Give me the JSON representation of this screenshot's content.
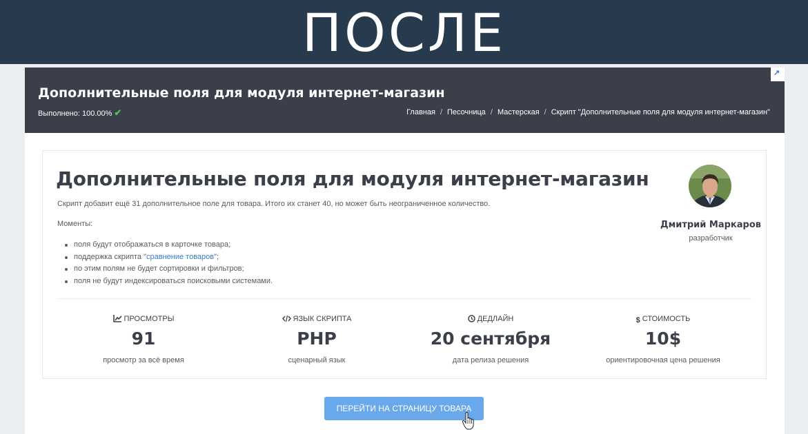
{
  "banner": {
    "text": "ПОСЛЕ"
  },
  "header": {
    "title": "Дополнительные поля для модуля интернет-магазин",
    "progress_label": "Выполнено: 100.00%",
    "breadcrumb": [
      "Главная",
      "Песочница",
      "Мастерская",
      "Скрипт \"Дополнительные поля для модуля интернет-магазин\""
    ]
  },
  "card": {
    "title": "Дополнительные поля для модуля интернет-магазин",
    "description": "Скрипт добавит ещё 31 дополнительное поле для товара. Итого их станет 40, но может быть неограниченное количество.",
    "moments_label": "Моменты:",
    "list": {
      "item1": "поля будут отображаться в карточке товара;",
      "item2_prefix": "поддержка скрипта \"",
      "item2_link": "сравнение товаров",
      "item2_suffix": "\";",
      "item3": "по этим полям не будет сортировки и фильтров;",
      "item4": "поля не будут индексироваться поисковыми системами."
    },
    "author": {
      "name": "Дмитрий Маркаров",
      "role": "разработчик"
    }
  },
  "stats": [
    {
      "icon": "chart-icon",
      "label": "ПРОСМОТРЫ",
      "value": "91",
      "sub": "просмотр за всё время"
    },
    {
      "icon": "code-icon",
      "label": "ЯЗЫК СКРИПТА",
      "value": "PHP",
      "sub": "сценарный язык"
    },
    {
      "icon": "clock-icon",
      "label": "ДЕДЛАЙН",
      "value": "20 сентября",
      "sub": "дата релиза решения"
    },
    {
      "icon": "dollar-icon",
      "label": "СТОИМОСТЬ",
      "value": "10$",
      "sub": "ориентировочная цена решения"
    }
  ],
  "cta": {
    "label": "ПЕРЕЙТИ НА СТРАНИЦУ ТОВАРА"
  },
  "colors": {
    "banner_bg": "#283a4d",
    "header_bg": "#3a3f4a",
    "accent_link": "#3a78c8",
    "success": "#4fc255",
    "button_bg": "#6aa8ec"
  }
}
